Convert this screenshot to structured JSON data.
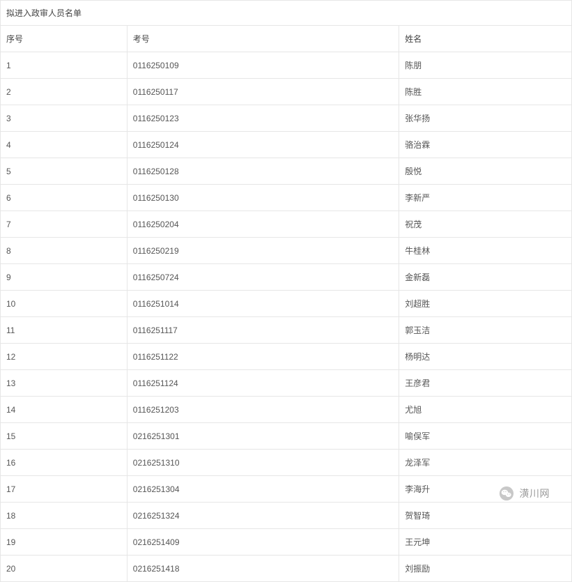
{
  "table": {
    "title": "拟进入政审人员名单",
    "headers": {
      "seq": "序号",
      "examNo": "考号",
      "name": "姓名"
    },
    "rows": [
      {
        "seq": "1",
        "examNo": "0116250109",
        "name": "陈朋"
      },
      {
        "seq": "2",
        "examNo": "0116250117",
        "name": "陈胜"
      },
      {
        "seq": "3",
        "examNo": "0116250123",
        "name": "张华扬"
      },
      {
        "seq": "4",
        "examNo": "0116250124",
        "name": "骆治霖"
      },
      {
        "seq": "5",
        "examNo": "0116250128",
        "name": "殷悦"
      },
      {
        "seq": "6",
        "examNo": "0116250130",
        "name": "李新严"
      },
      {
        "seq": "7",
        "examNo": "0116250204",
        "name": "祝茂"
      },
      {
        "seq": "8",
        "examNo": "0116250219",
        "name": "牛桂林"
      },
      {
        "seq": "9",
        "examNo": "0116250724",
        "name": "金新磊"
      },
      {
        "seq": "10",
        "examNo": "0116251014",
        "name": "刘超胜"
      },
      {
        "seq": "11",
        "examNo": "0116251117",
        "name": "郭玉洁"
      },
      {
        "seq": "12",
        "examNo": "0116251122",
        "name": "杨明达"
      },
      {
        "seq": "13",
        "examNo": "0116251124",
        "name": "王彦君"
      },
      {
        "seq": "14",
        "examNo": "0116251203",
        "name": "尤旭"
      },
      {
        "seq": "15",
        "examNo": "0216251301",
        "name": "喻俣军"
      },
      {
        "seq": "16",
        "examNo": "0216251310",
        "name": "龙泽军"
      },
      {
        "seq": "17",
        "examNo": "0216251304",
        "name": "李海升"
      },
      {
        "seq": "18",
        "examNo": "0216251324",
        "name": "贺智琦"
      },
      {
        "seq": "19",
        "examNo": "0216251409",
        "name": "王元坤"
      },
      {
        "seq": "20",
        "examNo": "0216251418",
        "name": "刘振励"
      }
    ]
  },
  "watermark": {
    "text": "潢川网"
  }
}
